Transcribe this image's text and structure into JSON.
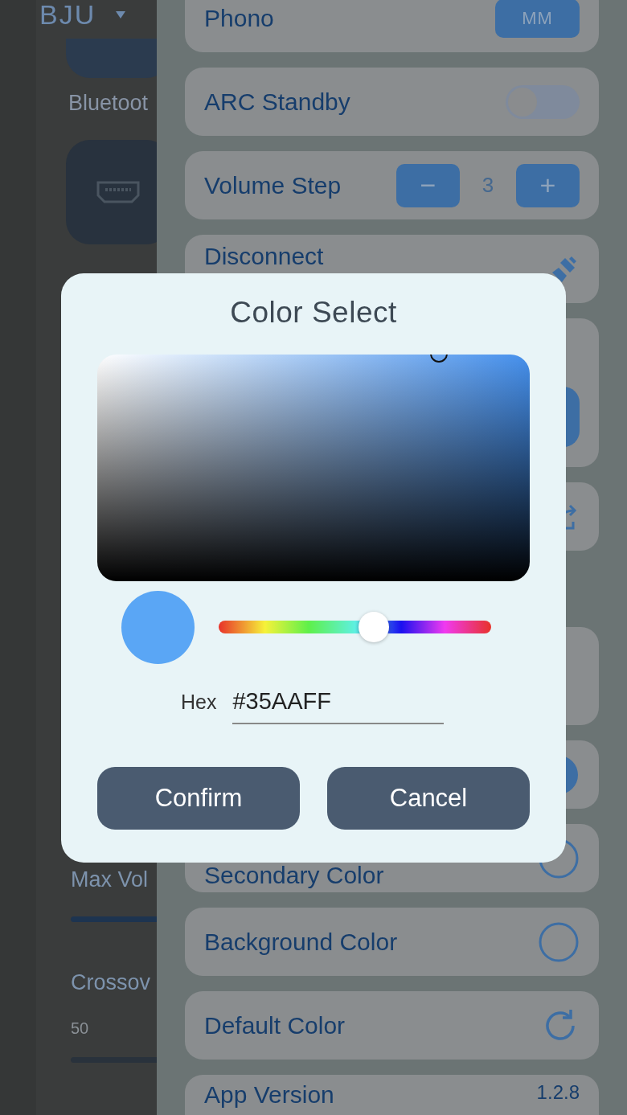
{
  "background_app": {
    "device_name": "BJU",
    "bluetooth_label": "Bluetoot",
    "max_volume_label": "Max Vol",
    "crossover_label": "Crossov",
    "crossover_value": "50"
  },
  "settings": [
    {
      "kind": "button",
      "label": "Phono",
      "value": "MM"
    },
    {
      "kind": "toggle",
      "label": "ARC Standby",
      "on": false
    },
    {
      "kind": "stepper",
      "label": "Volume Step",
      "value": "3",
      "minus": "−",
      "plus": "+"
    },
    {
      "kind": "plug",
      "label": "Disconnect"
    },
    {
      "kind": "large"
    },
    {
      "kind": "share"
    },
    {
      "kind": "plain"
    },
    {
      "kind": "dot"
    },
    {
      "kind": "ring",
      "label": "Secondary Color"
    },
    {
      "kind": "ring",
      "label": "Background Color"
    },
    {
      "kind": "refresh",
      "label": "Default Color"
    },
    {
      "kind": "version",
      "label": "App Version",
      "value": "1.2.8"
    }
  ],
  "dialog": {
    "title": "Color Select",
    "hue": {
      "level": 0.57
    },
    "preview": {
      "color": "#5aa6f5"
    },
    "hex_label": "Hex",
    "hex_value": "#35AAFF",
    "buttons": [
      "Confirm",
      "Cancel"
    ]
  }
}
